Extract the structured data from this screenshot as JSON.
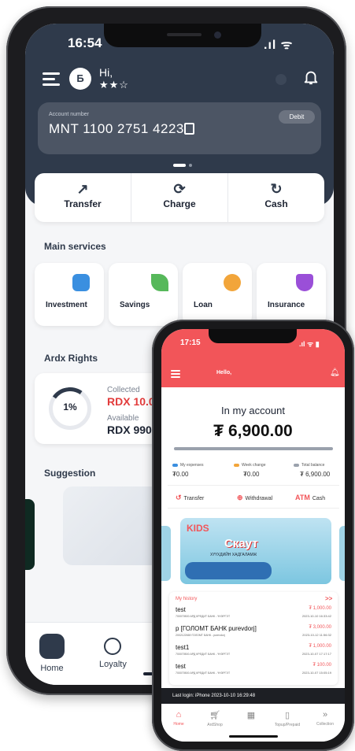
{
  "big_phone": {
    "status_time": "16:54",
    "avatar_initial": "Б",
    "greeting": "Hi,",
    "stars": "★★☆",
    "account": {
      "label": "Account number",
      "number": "MNT 1100 2751 4223",
      "type_badge": "Debit"
    },
    "actions": [
      {
        "label": "Transfer",
        "icon": "transfer-icon"
      },
      {
        "label": "Charge",
        "icon": "charge-icon"
      },
      {
        "label": "Cash",
        "icon": "cash-icon"
      }
    ],
    "main_services_title": "Main services",
    "services": [
      {
        "label": "Investment",
        "icon": "investment-icon",
        "color": "#3a8fe0"
      },
      {
        "label": "Savings",
        "icon": "savings-icon",
        "color": "#56b85a"
      },
      {
        "label": "Loan",
        "icon": "loan-icon",
        "color": "#f2a53a"
      },
      {
        "label": "Insurance",
        "icon": "insurance-icon",
        "color": "#9a4fd8"
      }
    ],
    "rights_title": "Ardx Rights",
    "rights": {
      "percent": "1%",
      "collected_label": "Collected",
      "collected_value": "RDX 10.00",
      "available_label": "Available",
      "available_value": "RDX 990.0"
    },
    "suggestion_title": "Suggestion",
    "tabs": [
      {
        "label": "Home",
        "icon": "home-icon"
      },
      {
        "label": "Loyalty",
        "icon": "loyalty-icon"
      }
    ]
  },
  "small_phone": {
    "status_time": "17:15",
    "header_title": "Hello,",
    "in_account_label": "In my account",
    "balance": "₮ 6,900.00",
    "legend": [
      {
        "label": "My expenses",
        "value": "₮0.00",
        "color": "#3a8fe0"
      },
      {
        "label": "Week change",
        "value": "₮0.00",
        "color": "#f2a53a"
      },
      {
        "label": "Total balance",
        "value": "₮ 6,900.00",
        "color": "#9aa1ac"
      }
    ],
    "actions": [
      {
        "label": "Transfer",
        "icon": "transfer-icon"
      },
      {
        "label": "Withdrawal",
        "icon": "plus-circle-icon"
      },
      {
        "label": "Cash",
        "prefix": "ATM"
      }
    ],
    "banner": {
      "kids": "KIDS",
      "title": "Скаут",
      "subtitle": "ХҮҮХДИЙН ХАДГАЛАМЖ"
    },
    "history_title": "My history",
    "history_more": ">>",
    "history": [
      {
        "name": "test",
        "detail": "700070500 АРД КРЕДИТ БАНК - ҮНЭРГЭТ",
        "amount": "₮ 1,000.00",
        "time": "2023-10-10 16:33:42"
      },
      {
        "name": "р [ГОЛОМТ БАНК purevdorj]",
        "detail": "2002122669 ГОЛОМТ БАНК - purevdorj",
        "amount": "₮ 3,000.00",
        "time": "2023-10-12 11:56:32"
      },
      {
        "name": "test1",
        "detail": "700070500 АРД КРЕДИТ БАНК - ҮНЭРГЭТ",
        "amount": "₮ 1,000.00",
        "time": "2023-10-07 17:17:17"
      },
      {
        "name": "test",
        "detail": "700070500 АРД КРЕДИТ БАНК - ҮНЭРГЭТ",
        "amount": "₮ 100.00",
        "time": "2023-10-07 15:05:19"
      }
    ],
    "last_login": "Last login: iPhone 2023-10-10 16:29:48",
    "tabs": [
      {
        "label": "Home",
        "icon": "home-icon"
      },
      {
        "label": "ArdShop",
        "icon": "cart-icon"
      },
      {
        "label": "",
        "icon": "qr-icon"
      },
      {
        "label": "Topup/Prepaid",
        "icon": "phone-icon"
      },
      {
        "label": "Collection",
        "icon": "chevrons-icon"
      }
    ]
  }
}
